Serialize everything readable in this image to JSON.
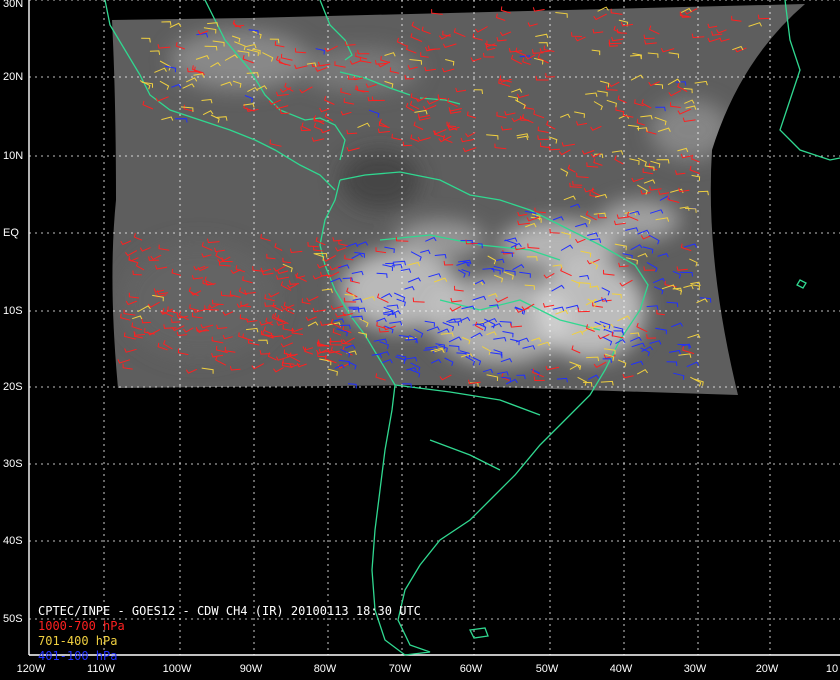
{
  "map": {
    "caption": "CPTEC/INPE - GOES12 - CDW CH4 (IR) 20100113 18:30 UTC",
    "legend": [
      {
        "label": "1000-700 hPa",
        "color": "#ff2020"
      },
      {
        "label": "701-400 hPa",
        "color": "#f0d040"
      },
      {
        "label": "401-100 hPa",
        "color": "#2030ff"
      }
    ],
    "lat_labels": [
      "30N",
      "20N",
      "10N",
      "EQ",
      "10S",
      "20S",
      "30S",
      "40S",
      "50S"
    ],
    "lon_labels": [
      "120W",
      "110W",
      "100W",
      "90W",
      "80W",
      "70W",
      "60W",
      "50W",
      "40W",
      "30W",
      "20W",
      "10"
    ],
    "colors": {
      "background": "#000000",
      "coastline": "#30d890",
      "grid": "#ffffff",
      "image_gray": "#6e6e6e"
    }
  }
}
